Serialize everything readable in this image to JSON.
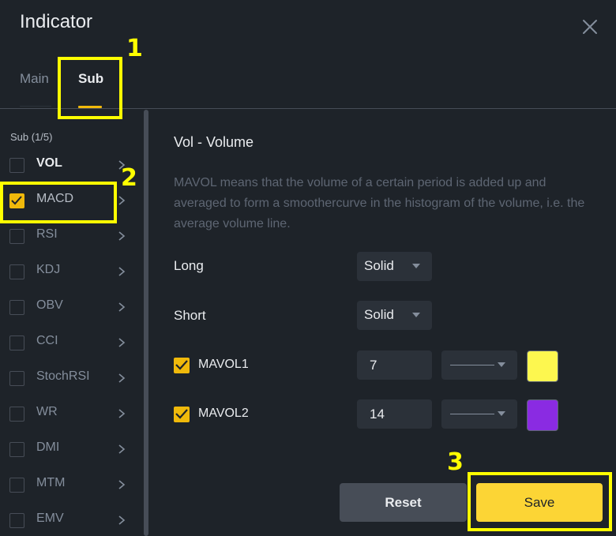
{
  "dialog": {
    "title": "Indicator"
  },
  "tabs": [
    {
      "label": "Main",
      "active": false
    },
    {
      "label": "Sub",
      "active": true
    }
  ],
  "sidebar": {
    "heading": "Sub (1/5)",
    "items": [
      {
        "label": "VOL",
        "checked": false
      },
      {
        "label": "MACD",
        "checked": true
      },
      {
        "label": "RSI",
        "checked": false
      },
      {
        "label": "KDJ",
        "checked": false
      },
      {
        "label": "OBV",
        "checked": false
      },
      {
        "label": "CCI",
        "checked": false
      },
      {
        "label": "StochRSI",
        "checked": false
      },
      {
        "label": "WR",
        "checked": false
      },
      {
        "label": "DMI",
        "checked": false
      },
      {
        "label": "MTM",
        "checked": false
      },
      {
        "label": "EMV",
        "checked": false
      }
    ]
  },
  "panel": {
    "title": "Vol - Volume",
    "description": "MAVOL means that the volume of a certain period is added up and averaged to form a smoothercurve in the histogram of the volume, i.e. the average volume line.",
    "long": {
      "label": "Long",
      "value": "Solid"
    },
    "short": {
      "label": "Short",
      "value": "Solid"
    },
    "mavol1": {
      "label": "MAVOL1",
      "checked": true,
      "period": "7",
      "color": "#fdf74f"
    },
    "mavol2": {
      "label": "MAVOL2",
      "checked": true,
      "period": "14",
      "color": "#8a2be2"
    }
  },
  "buttons": {
    "reset": "Reset",
    "save": "Save"
  },
  "annotations": [
    {
      "label": "1"
    },
    {
      "label": "2"
    },
    {
      "label": "3"
    }
  ],
  "colors": {
    "accent": "#f0b90b",
    "highlight": "#ffff00",
    "background": "#1e2329"
  }
}
